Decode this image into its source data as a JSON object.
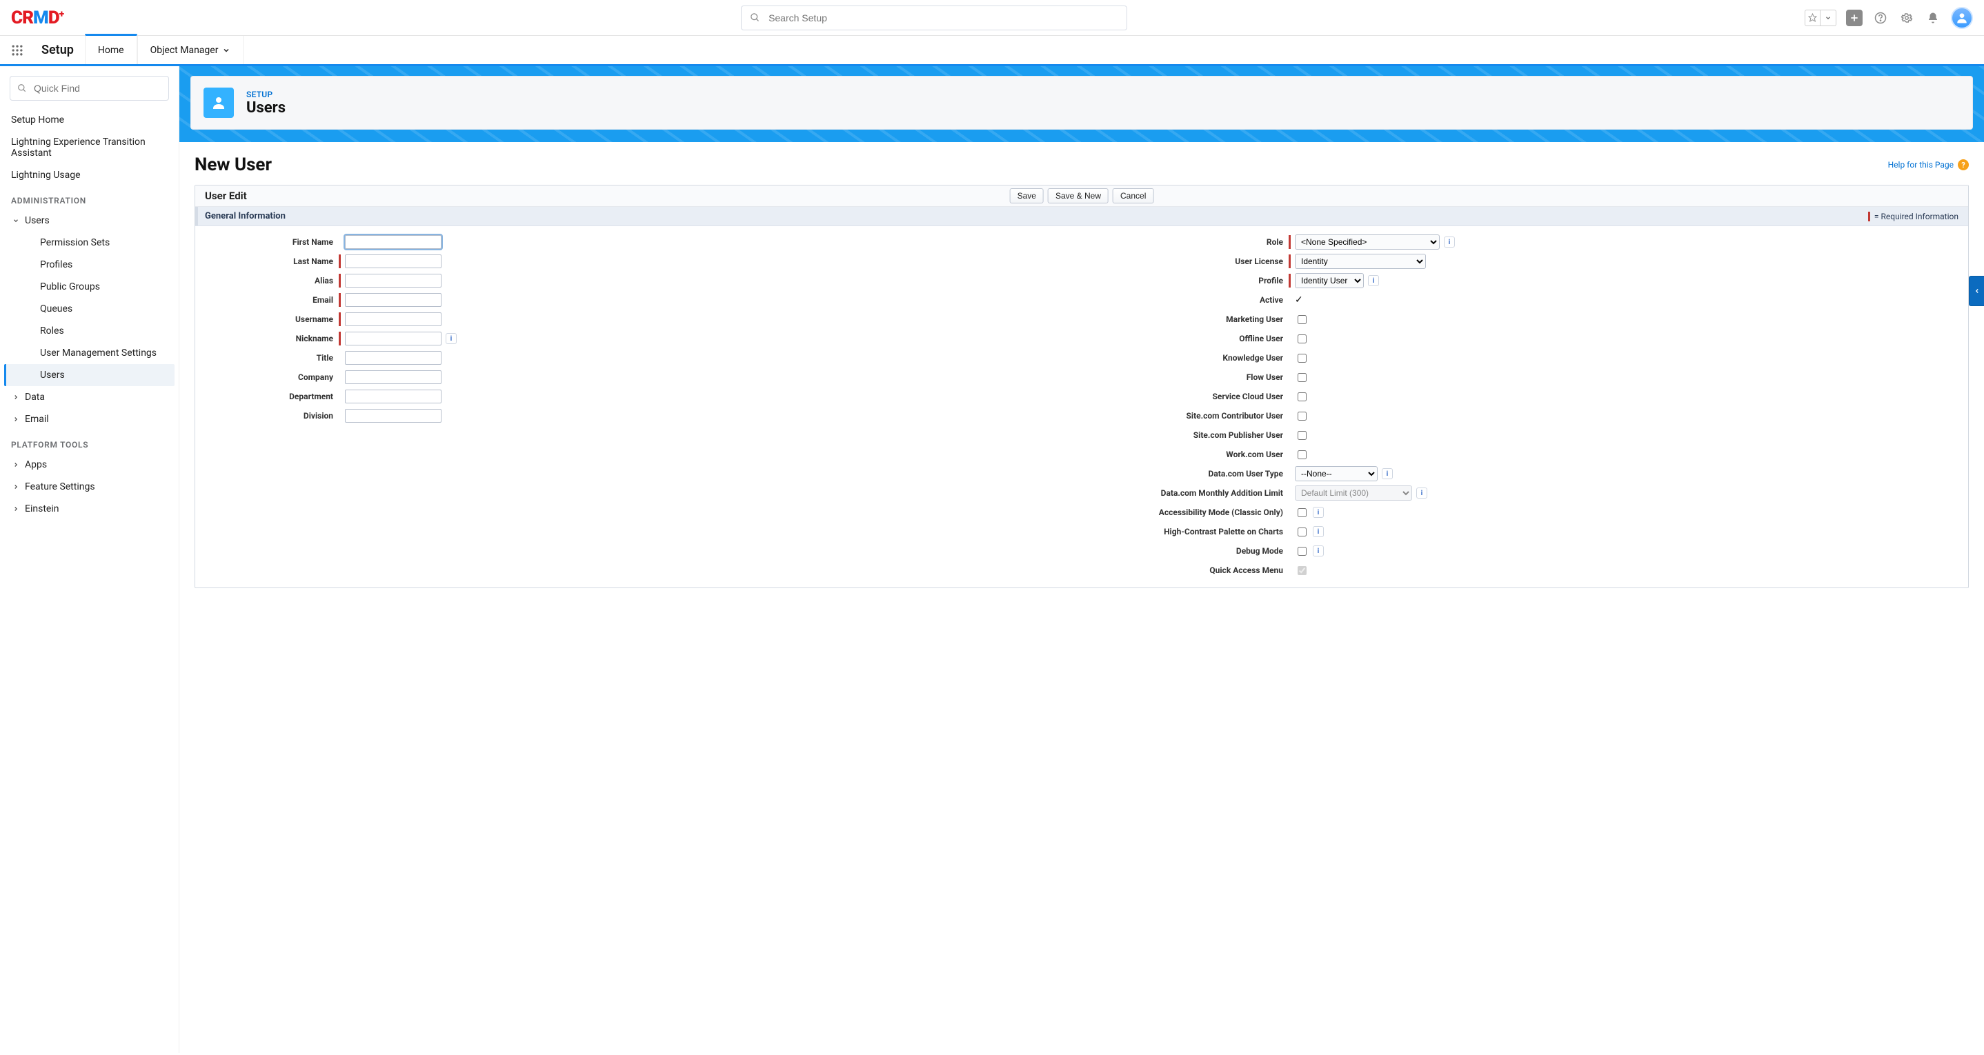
{
  "header": {
    "logo_text": "CRMD",
    "search_placeholder": "Search Setup"
  },
  "context_bar": {
    "title": "Setup",
    "tabs": {
      "home": "Home",
      "object_manager": "Object Manager"
    }
  },
  "sidebar": {
    "quick_find_placeholder": "Quick Find",
    "links": {
      "setup_home": "Setup Home",
      "transition": "Lightning Experience Transition Assistant",
      "usage": "Lightning Usage"
    },
    "sections": {
      "administration": "ADMINISTRATION",
      "platform_tools": "PLATFORM TOOLS"
    },
    "users_group": {
      "label": "Users",
      "items": {
        "permission_sets": "Permission Sets",
        "profiles": "Profiles",
        "public_groups": "Public Groups",
        "queues": "Queues",
        "roles": "Roles",
        "user_mgmt": "User Management Settings",
        "users": "Users"
      }
    },
    "data": "Data",
    "email": "Email",
    "apps": "Apps",
    "feature_settings": "Feature Settings",
    "einstein": "Einstein"
  },
  "hero": {
    "eyebrow": "SETUP",
    "title": "Users"
  },
  "page": {
    "title": "New User",
    "help_link": "Help for this Page"
  },
  "panel": {
    "title": "User Edit",
    "buttons": {
      "save": "Save",
      "save_new": "Save & New",
      "cancel": "Cancel"
    },
    "subheader": "General Information",
    "required_note": "= Required Information"
  },
  "form_left": {
    "first_name": "First Name",
    "last_name": "Last Name",
    "alias": "Alias",
    "email": "Email",
    "username": "Username",
    "nickname": "Nickname",
    "title": "Title",
    "company": "Company",
    "department": "Department",
    "division": "Division"
  },
  "form_right": {
    "role": "Role",
    "user_license": "User License",
    "profile": "Profile",
    "active": "Active",
    "marketing_user": "Marketing User",
    "offline_user": "Offline User",
    "knowledge_user": "Knowledge User",
    "flow_user": "Flow User",
    "service_cloud_user": "Service Cloud User",
    "site_contrib": "Site.com Contributor User",
    "site_pub": "Site.com Publisher User",
    "work_user": "Work.com User",
    "data_user_type": "Data.com User Type",
    "data_monthly": "Data.com Monthly Addition Limit",
    "accessibility": "Accessibility Mode (Classic Only)",
    "high_contrast": "High-Contrast Palette on Charts",
    "debug": "Debug Mode",
    "quick_access": "Quick Access Menu"
  },
  "selects": {
    "role_value": "<None Specified>",
    "license_value": "Identity",
    "profile_value": "Identity User",
    "data_user_value": "--None--",
    "data_monthly_value": "Default Limit (300)"
  }
}
